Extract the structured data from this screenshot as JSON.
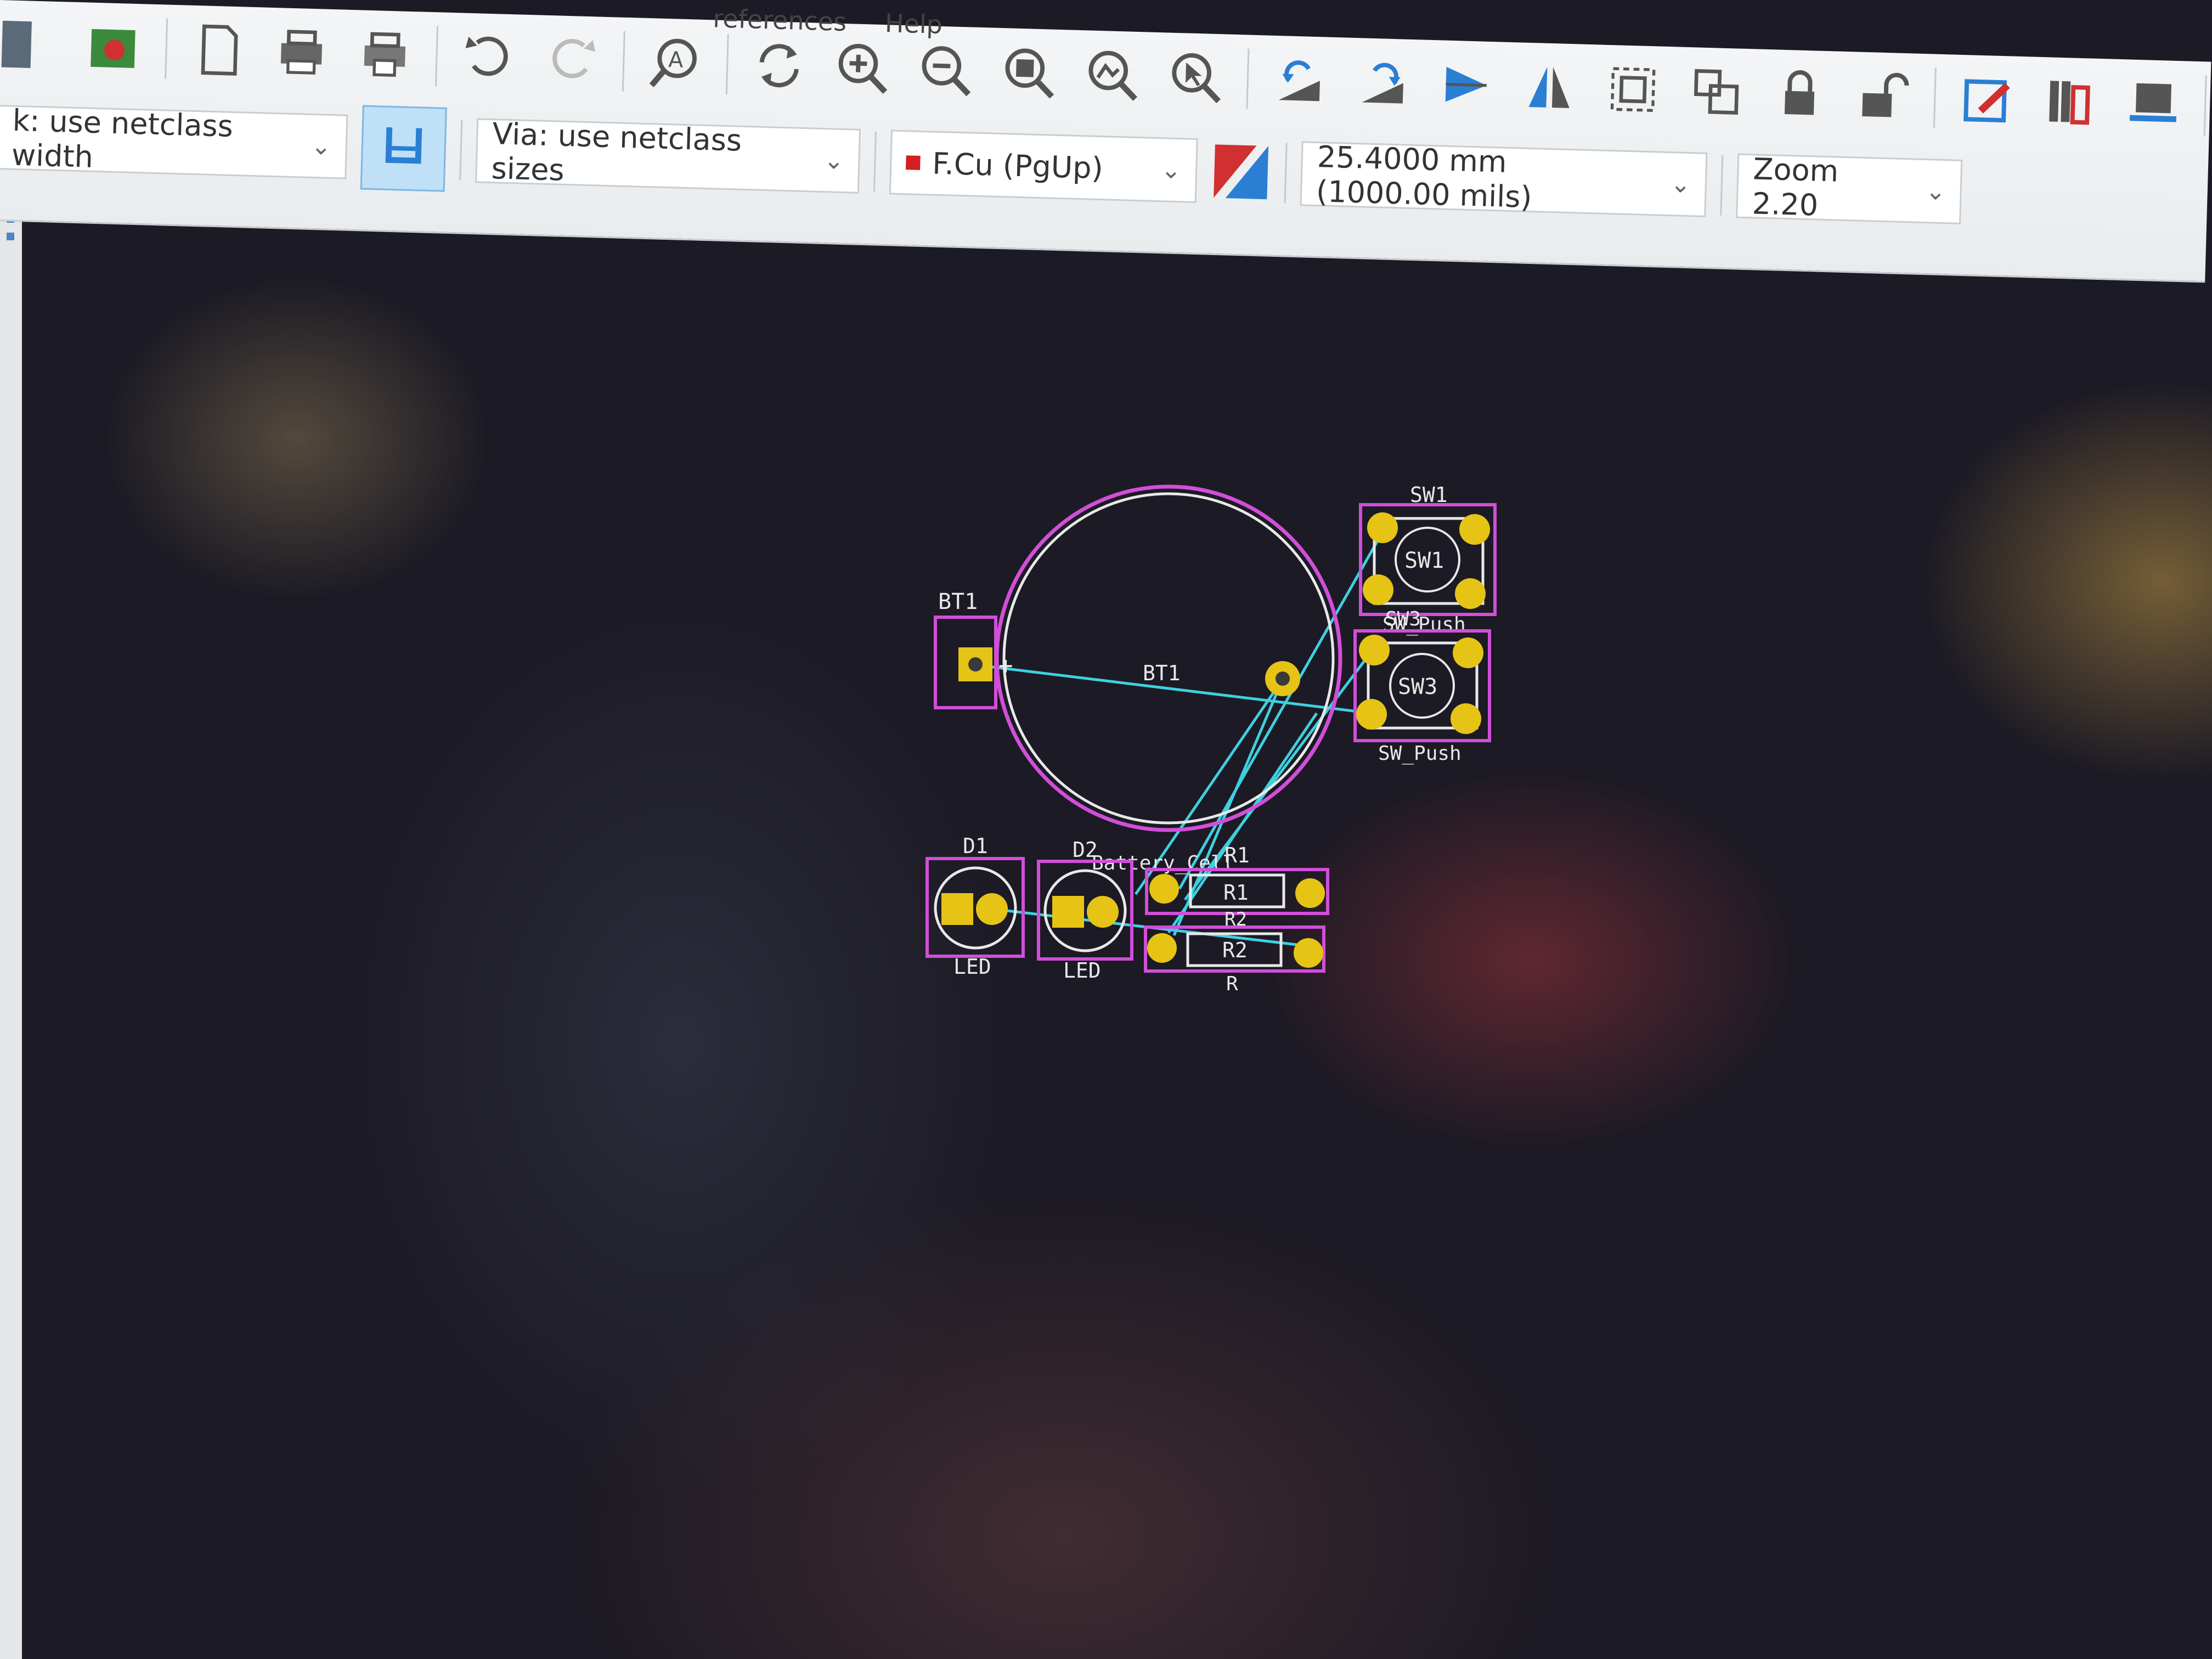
{
  "menu": {
    "preferences": "references",
    "help": "Help"
  },
  "toolbar": {
    "track_width": "k: use netclass width",
    "via_size": "Via: use netclass sizes",
    "layer": "F.Cu (PgUp)",
    "grid": "25.4000 mm (1000.00 mils)",
    "zoom": "Zoom 2.20"
  },
  "board": {
    "bt1": {
      "ref": "BT1",
      "value": "BT1",
      "fab": "Battery_Cell",
      "plus": "+"
    },
    "sw1": {
      "ref": "SW1",
      "value": "SW1",
      "fab": "SW_Push"
    },
    "sw3": {
      "ref": "SW3",
      "value": "SW3",
      "fab": "SW_Push"
    },
    "d1": {
      "ref": "D1",
      "value": "LED"
    },
    "d2": {
      "ref": "D2",
      "value": "LED"
    },
    "r1": {
      "ref": "R1",
      "value": "R1",
      "fab": "R2"
    },
    "r2": {
      "ref": "R2",
      "value": "R2",
      "fab": "R"
    }
  },
  "colors": {
    "background": "#1c1a24",
    "pad": "#e6c416",
    "courtyard": "#d04fd8",
    "ratsnest": "#3fd0e0",
    "silkscreen": "#f2f2f2"
  }
}
